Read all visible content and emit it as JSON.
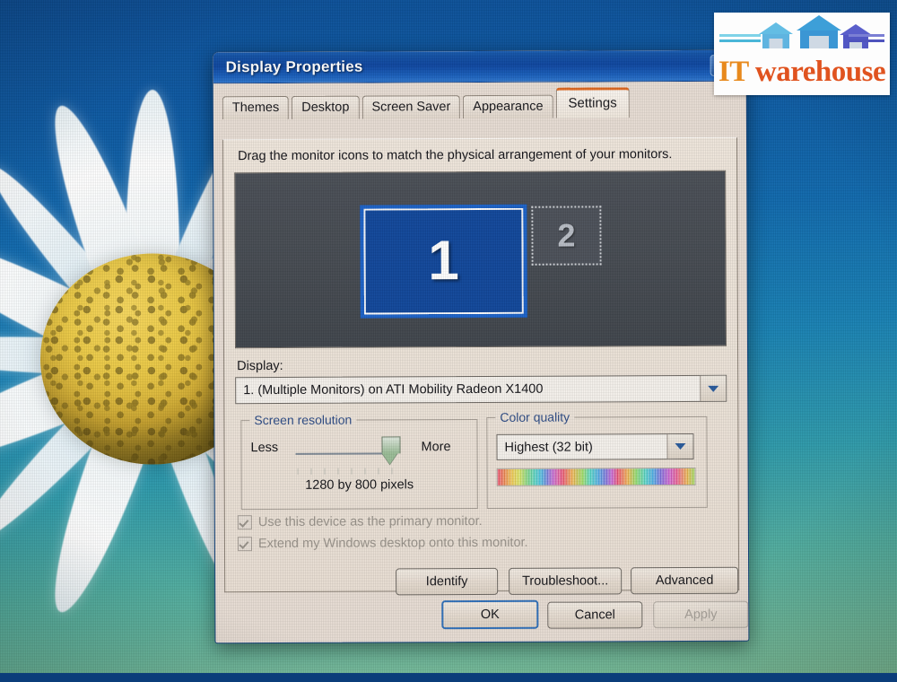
{
  "window": {
    "title": "Display Properties",
    "close_label": "",
    "icons": {
      "close": "close-icon"
    }
  },
  "tabs": [
    {
      "label": "Themes",
      "active": false
    },
    {
      "label": "Desktop",
      "active": false
    },
    {
      "label": "Screen Saver",
      "active": false
    },
    {
      "label": "Appearance",
      "active": false
    },
    {
      "label": "Settings",
      "active": true
    }
  ],
  "settings": {
    "hint": "Drag the monitor icons to match the physical arrangement of your monitors.",
    "monitors": [
      {
        "number": "1",
        "state": "selected"
      },
      {
        "number": "2",
        "state": "disabled"
      }
    ],
    "display": {
      "label": "Display:",
      "value": "1. (Multiple Monitors) on ATI Mobility Radeon X1400",
      "dropdown_icon": "chevron-down-icon"
    },
    "screen_resolution": {
      "group_label": "Screen resolution",
      "less_label": "Less",
      "more_label": "More",
      "value_text": "1280 by 800 pixels",
      "slider_percent": 88
    },
    "color_quality": {
      "group_label": "Color quality",
      "value": "Highest (32 bit)",
      "dropdown_icon": "chevron-down-icon"
    },
    "checkboxes": [
      {
        "label": "Use this device as the primary monitor.",
        "checked": true,
        "disabled": true
      },
      {
        "label": "Extend my Windows desktop onto this monitor.",
        "checked": true,
        "disabled": true
      }
    ],
    "action_buttons": [
      {
        "label": "Identify",
        "enabled": true
      },
      {
        "label": "Troubleshoot...",
        "enabled": true
      },
      {
        "label": "Advanced",
        "enabled": true
      }
    ]
  },
  "footer_buttons": [
    {
      "label": "OK",
      "enabled": true,
      "default": true
    },
    {
      "label": "Cancel",
      "enabled": true,
      "default": false
    },
    {
      "label": "Apply",
      "enabled": false,
      "default": false
    }
  ],
  "watermark": {
    "text_it": "IT",
    "text_warehouse": " warehouse",
    "colors": {
      "it": "#e8891c",
      "warehouse": "#e0531f"
    }
  },
  "theme": {
    "titlebar_blue": "#0f47a0",
    "active_tab_accent": "#e06a22",
    "monitor_selected_blue": "#12489b",
    "dialog_face": "#e7ddd4",
    "wallpaper": "blue-daisy-flower"
  }
}
